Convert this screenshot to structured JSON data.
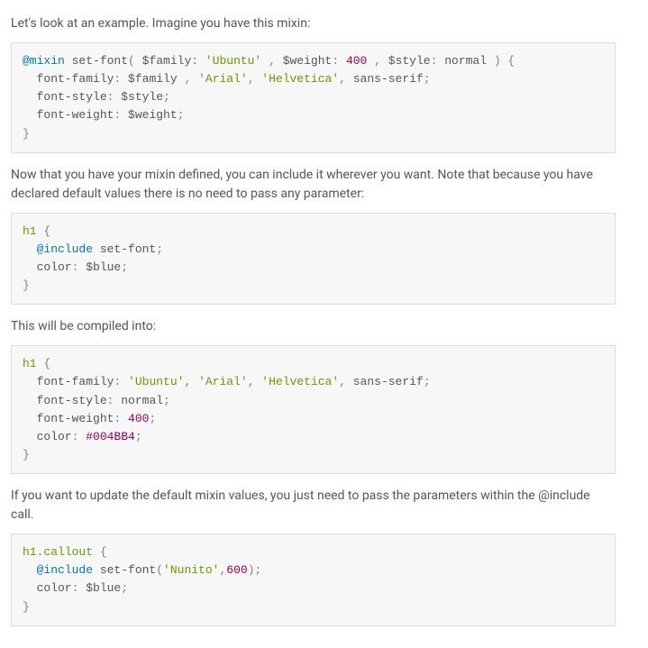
{
  "p1": "Let's look at an example. Imagine you have this mixin:",
  "code1": {
    "l1a": "@mixin",
    "l1b": " set-font",
    "l1c": "(",
    "l1d": " $family",
    "l1e": ":",
    "l1f": " 'Ubuntu'",
    "l1g": " ,",
    "l1h": " $weight",
    "l1i": ":",
    "l1j": " 400",
    "l1k": " ,",
    "l1l": " $style",
    "l1m": ":",
    "l1n": " normal ",
    "l1o": ")",
    "l1p": " {",
    "l2a": "  font-family",
    "l2b": ":",
    "l2c": " $family ",
    "l2d": ",",
    "l2e": " 'Arial'",
    "l2f": ",",
    "l2g": " 'Helvetica'",
    "l2h": ",",
    "l2i": " sans-serif",
    "l2j": ";",
    "l3a": "  font-style",
    "l3b": ":",
    "l3c": " $style",
    "l3d": ";",
    "l4a": "  font-weight",
    "l4b": ":",
    "l4c": " $weight",
    "l4d": ";",
    "l5a": "}"
  },
  "p2": "Now that you have your mixin defined, you can include it wherever you want. Note that because you have declared default values there is no need to pass any parameter:",
  "code2": {
    "l1a": "h1",
    "l1b": " {",
    "l2a": "  @include",
    "l2b": " set-font",
    "l2c": ";",
    "l3a": "  color",
    "l3b": ":",
    "l3c": " $blue",
    "l3d": ";",
    "l4a": "}"
  },
  "p3": "This will be compiled into:",
  "code3": {
    "l1a": "h1",
    "l1b": " {",
    "l2a": "  font-family",
    "l2b": ":",
    "l2c": " 'Ubuntu'",
    "l2d": ",",
    "l2e": " 'Arial'",
    "l2f": ",",
    "l2g": " 'Helvetica'",
    "l2h": ",",
    "l2i": " sans-serif",
    "l2j": ";",
    "l3a": "  font-style",
    "l3b": ":",
    "l3c": " normal",
    "l3d": ";",
    "l4a": "  font-weight",
    "l4b": ":",
    "l4c": " 400",
    "l4d": ";",
    "l5a": "  color",
    "l5b": ":",
    "l5c": " #004BB4",
    "l5d": ";",
    "l6a": "}"
  },
  "p4a": "If you want to update the default mixin values, you just need to pass the parameters within the ",
  "p4b": "@include",
  "p4c": " call.",
  "code4": {
    "l1a": "h1",
    "l1b": ".callout",
    "l1c": " {",
    "l2a": "  @include",
    "l2b": " set-font",
    "l2c": "(",
    "l2d": "'Nunito'",
    "l2e": ",",
    "l2f": "600",
    "l2g": ")",
    "l2h": ";",
    "l3a": "  color",
    "l3b": ":",
    "l3c": " $blue",
    "l3d": ";",
    "l4a": "}"
  }
}
